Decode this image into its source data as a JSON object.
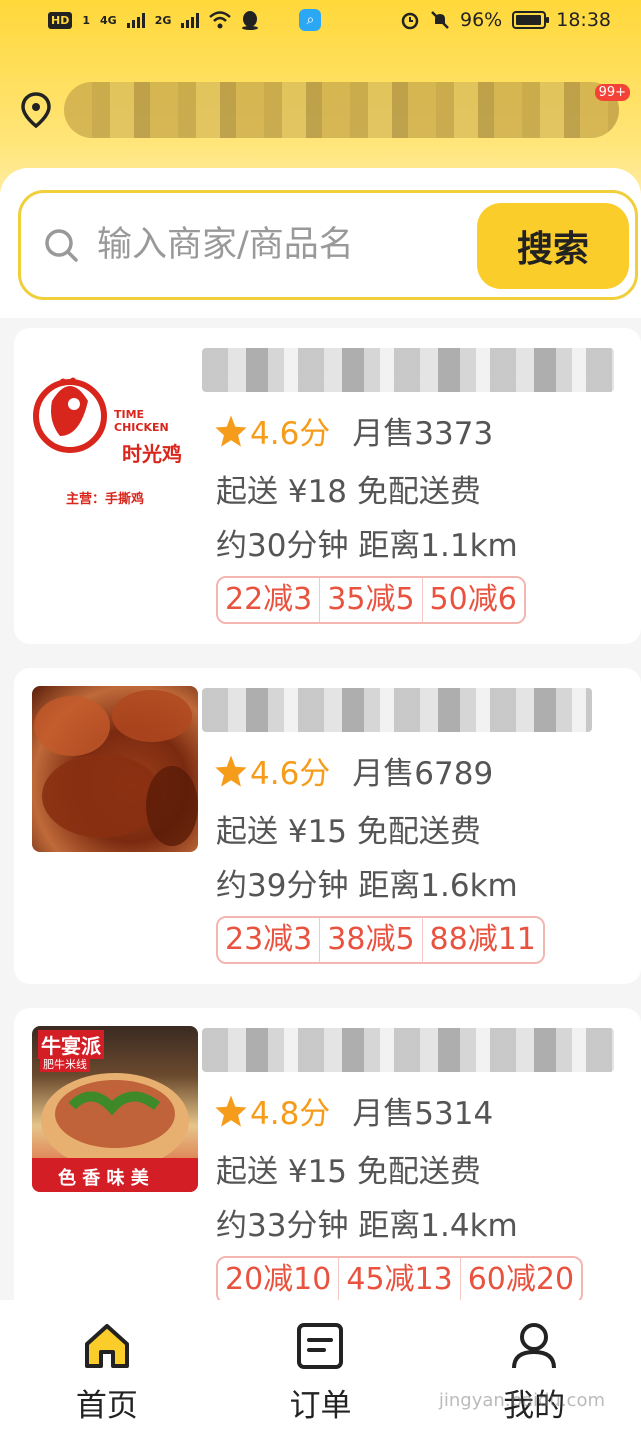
{
  "status_bar": {
    "left_icons": [
      "HD",
      "1",
      "4G",
      "2G"
    ],
    "battery": "96%",
    "battery_level": 0.96,
    "time": "18:38"
  },
  "location": {
    "badge": "99+"
  },
  "search": {
    "placeholder": "输入商家/商品名",
    "button_label": "搜索"
  },
  "stores": [
    {
      "logo_en": "TIME CHICKEN",
      "logo_cn": "时光鸡",
      "logo_main": "主营：手撕鸡",
      "rating": "4.6分",
      "monthly_sales": "月售3373",
      "delivery": "起送 ¥18  免配送费",
      "eta": "约30分钟  距离1.1km",
      "promos": [
        "22减3",
        "35减5",
        "50减6"
      ]
    },
    {
      "rating": "4.6分",
      "monthly_sales": "月售6789",
      "delivery": "起送 ¥15  免配送费",
      "eta": "约39分钟  距离1.6km",
      "promos": [
        "23减3",
        "38减5",
        "88减11"
      ]
    },
    {
      "logo_title": "牛宴派",
      "logo_sub": "肥牛米线",
      "logo_slogan": "色 香 味 美",
      "rating": "4.8分",
      "monthly_sales": "月售5314",
      "delivery": "起送 ¥15  免配送费",
      "eta": "约33分钟  距离1.4km",
      "promos": [
        "20减10",
        "45减13",
        "60减20"
      ]
    }
  ],
  "nav": {
    "home": "首页",
    "orders": "订单",
    "mine": "我的"
  },
  "watermark": "jingyan.baidu.com",
  "colors": {
    "accent": "#fbcd2b",
    "rating": "#f59c1a",
    "promo": "#e8523f"
  }
}
